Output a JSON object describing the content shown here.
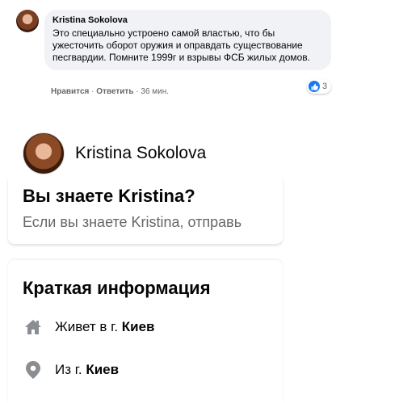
{
  "comment": {
    "author": "Kristina Sokolova",
    "text": "Это специально устроено самой властью, что бы ужесточить оборот оружия и оправдать существование песгвардии. Помните 1999г и взрывы ФСБ жилых домов.",
    "like_action": "Нравится",
    "separator": "·",
    "reply_action": "Ответить",
    "time": "36 мин.",
    "reaction_count": "3",
    "reaction_icon": "like-icon",
    "reaction_color": "#1877f2"
  },
  "profile": {
    "name": "Kristina Sokolova"
  },
  "know_card": {
    "title": "Вы знаете Kristina?",
    "subtitle": "Если вы знаете Kristina, отправь"
  },
  "intro": {
    "title": "Краткая информация",
    "rows": [
      {
        "icon": "home-icon",
        "prefix": "Живет в г. ",
        "value": "Киев"
      },
      {
        "icon": "location-pin-icon",
        "prefix": "Из г. ",
        "value": "Киев"
      }
    ]
  },
  "colors": {
    "secondary_text": "#65676b",
    "bubble_bg": "#f0f2f5",
    "icon_gray": "#8a8d91"
  }
}
